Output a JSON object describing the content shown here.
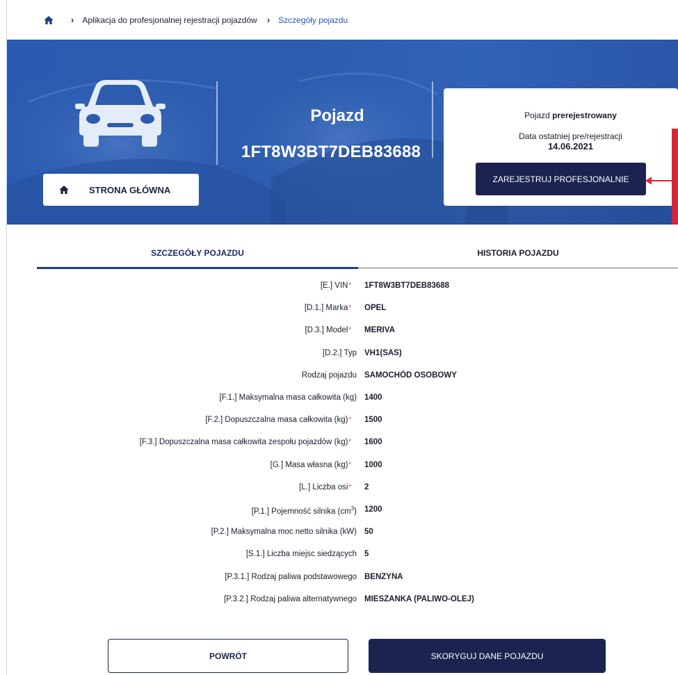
{
  "breadcrumb": {
    "items": [
      {
        "label": "Aplikacja do profesjonalnej rejestracji pojazdów"
      },
      {
        "label": "Szczegóły pojazdu"
      }
    ]
  },
  "hero": {
    "home_button_label": "STRONA GŁÓWNA",
    "vehicle_title": "Pojazd",
    "vehicle_vin": "1FT8W3BT7DEB83688"
  },
  "status_card": {
    "status_prefix": "Pojazd ",
    "status_value": "prerejestrowany",
    "date_label": "Data ostatniej pre/rejestracji",
    "date_value": "14.06.2021",
    "register_button_label": "ZAREJESTRUJ PROFESJONALNIE"
  },
  "tabs": [
    {
      "label": "SZCZEGÓŁY POJAZDU",
      "active": true
    },
    {
      "label": "HISTORIA POJAZDU",
      "active": false
    }
  ],
  "details": [
    {
      "label": "[E.] VIN",
      "required": true,
      "value": "1FT8W3BT7DEB83688"
    },
    {
      "label": "[D.1.] Marka",
      "required": true,
      "value": "OPEL"
    },
    {
      "label": "[D.3.] Model",
      "required": true,
      "value": "MERIVA"
    },
    {
      "label": "[D.2.] Typ",
      "required": false,
      "value": "VH1(SAS)"
    },
    {
      "label": "Rodzaj pojazdu",
      "required": false,
      "value": "SAMOCHÓD OSOBOWY"
    },
    {
      "label": "[F.1.] Maksymalna masa całkowita (kg)",
      "required": false,
      "value": "1400"
    },
    {
      "label": "[F.2.] Dopuszczalna masa całkowita (kg)",
      "required": true,
      "value": "1500"
    },
    {
      "label": "[F.3.] Dopuszczalna masa całkowita zespołu pojazdów (kg)",
      "required": true,
      "value": "1600"
    },
    {
      "label": "[G.] Masa własna (kg)",
      "required": true,
      "value": "1000"
    },
    {
      "label": "[L.] Liczba osi",
      "required": true,
      "value": "2"
    },
    {
      "label": "[P.1.] Pojemność silnika (cm",
      "label_sup": "3",
      "label_suffix": ")",
      "required": false,
      "value": "1200"
    },
    {
      "label": "[P.2.] Maksymalna moc netto silnika (kW)",
      "required": false,
      "value": "50"
    },
    {
      "label": "[S.1.] Liczba miejsc siedzących",
      "required": false,
      "value": "5"
    },
    {
      "label": "[P.3.1.] Rodzaj paliwa podstawowego",
      "required": false,
      "value": "BENZYNA"
    },
    {
      "label": "[P.3.2.] Rodzaj paliwa alternatywnego",
      "required": false,
      "value": "MIESZANKA (PALIWO-OLEJ)"
    }
  ],
  "required_marker": "*",
  "buttons": {
    "back_label": "POWRÓT",
    "correct_label": "SKORYGUJ DANE POJAZDU"
  },
  "colors": {
    "primary_dark": "#1b2350",
    "hero_blue": "#2d5cae",
    "accent_link": "#2255c4",
    "annotation_red": "#dc2338"
  },
  "icons": {
    "home": "home-icon",
    "chevron": "chevron-right-icon",
    "car": "car-icon",
    "arrow": "arrow-left-icon"
  }
}
